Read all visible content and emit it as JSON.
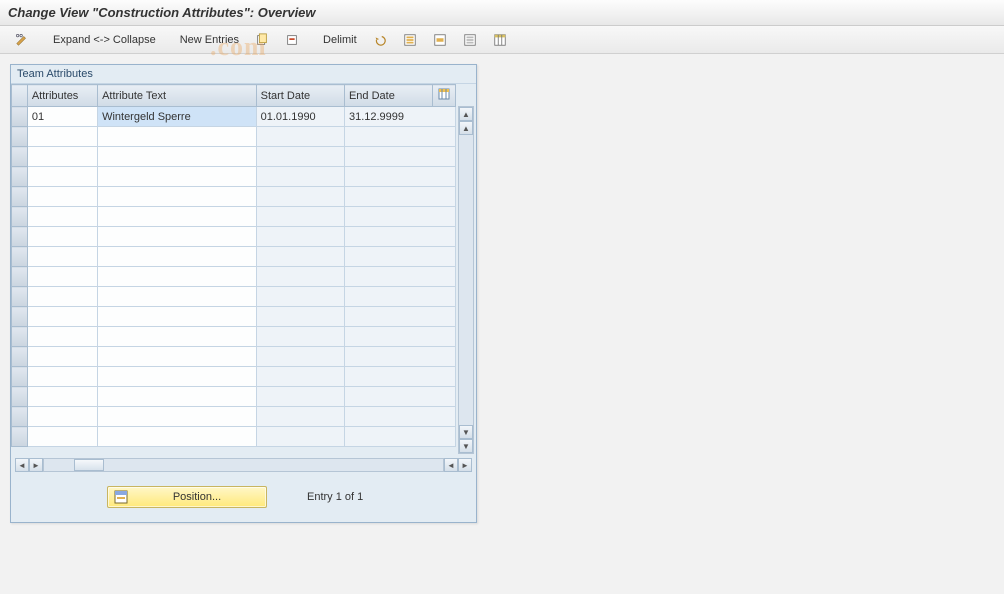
{
  "title": "Change View \"Construction Attributes\": Overview",
  "toolbar": {
    "expand_collapse": "Expand <-> Collapse",
    "new_entries": "New Entries",
    "delimit": "Delimit"
  },
  "panel": {
    "title": "Team Attributes",
    "columns": {
      "attributes": "Attributes",
      "attribute_text": "Attribute Text",
      "start_date": "Start Date",
      "end_date": "End Date"
    },
    "rows": [
      {
        "attributes": "01",
        "attribute_text": "Wintergeld Sperre",
        "start_date": "01.01.1990",
        "end_date": "31.12.9999"
      }
    ]
  },
  "footer": {
    "position_label": "Position...",
    "entry_status": "Entry 1 of 1"
  }
}
